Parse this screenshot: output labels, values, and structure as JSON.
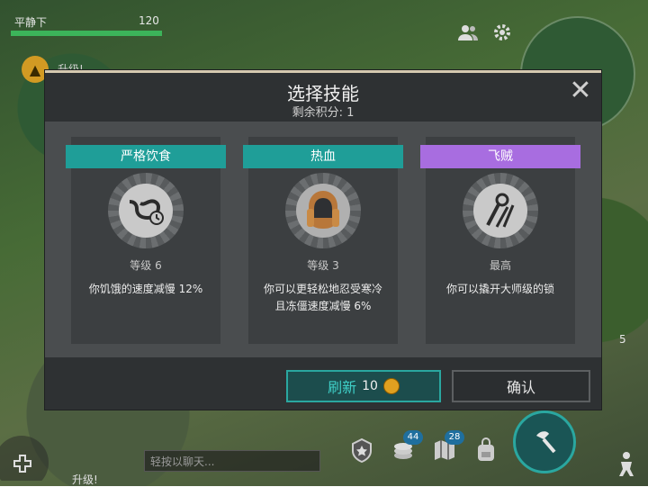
{
  "hud": {
    "status_text": "平静下",
    "health_value": "120",
    "health_fraction": 1.0,
    "levelup_label": "升级!",
    "right_counter": "5",
    "chat_placeholder": "轻按以聊天...",
    "bottom_levelup_label": "升级!",
    "badge_chests": "44",
    "badge_quests": "28"
  },
  "dialog": {
    "title": "选择技能",
    "points_label": "剩余积分:  1",
    "close_icon": "close-icon",
    "cards": [
      {
        "name": "严格饮食",
        "ribbon_color": "#1f9e98",
        "level": "等级 6",
        "description": "你饥饿的速度减慢 12%",
        "icon": "stomach-clock-icon"
      },
      {
        "name": "热血",
        "ribbon_color": "#1f9e98",
        "level": "等级 3",
        "description_line1": "你可以更轻松地忍受寒冷",
        "description_line2": "且冻僵速度减慢 6%",
        "icon": "fur-hat-icon"
      },
      {
        "name": "飞贼",
        "ribbon_color": "#a86de0",
        "level": "最高",
        "description": "你可以撬开大师级的锁",
        "icon": "lockpick-icon"
      }
    ],
    "refresh_label": "刷新",
    "refresh_cost": "10",
    "confirm_label": "确认"
  }
}
